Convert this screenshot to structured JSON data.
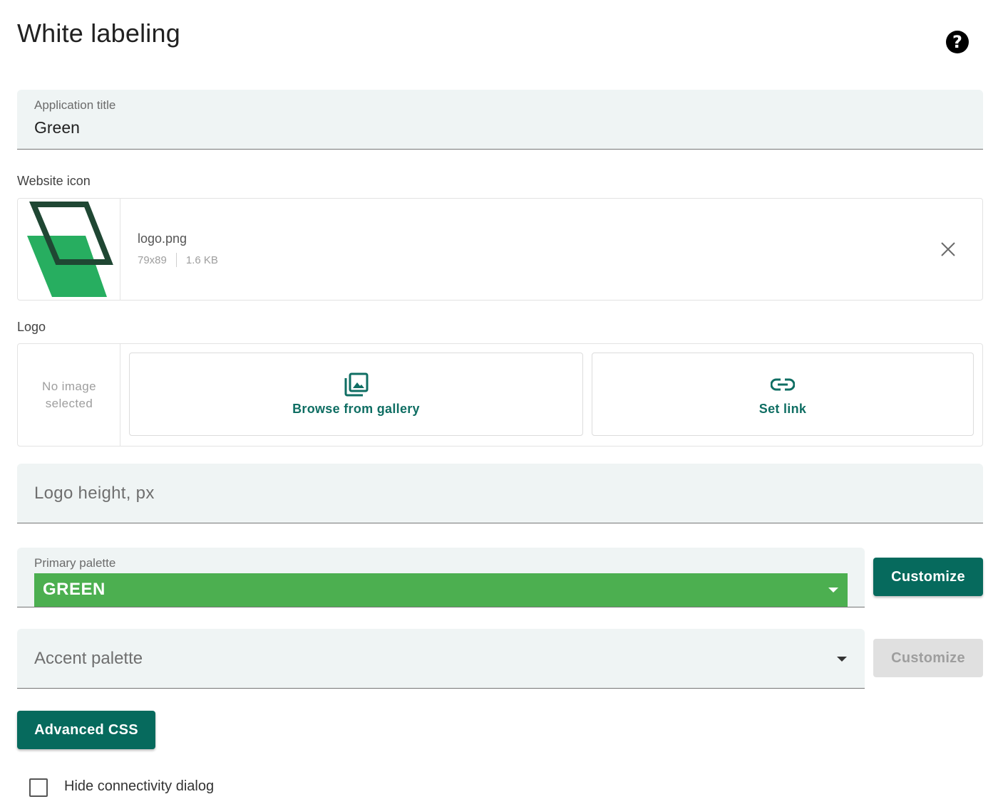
{
  "page": {
    "title": "White labeling",
    "help_icon": "?"
  },
  "app_title": {
    "label": "Application title",
    "value": "Green"
  },
  "website_icon": {
    "label": "Website icon",
    "file_name": "logo.png",
    "dimensions": "79x89",
    "size": "1.6 KB",
    "icon_color_dark": "#1f4733",
    "icon_color_green": "#27ae60"
  },
  "logo": {
    "label": "Logo",
    "no_image_text": "No image selected",
    "browse_label": "Browse from gallery",
    "set_link_label": "Set link"
  },
  "logo_height": {
    "placeholder": "Logo height, px"
  },
  "primary_palette": {
    "label": "Primary palette",
    "value": "GREEN",
    "color": "#4caf50",
    "customize_label": "Customize"
  },
  "accent_palette": {
    "placeholder": "Accent palette",
    "customize_label": "Customize"
  },
  "advanced_css": {
    "label": "Advanced CSS"
  },
  "hide_connectivity": {
    "label": "Hide connectivity dialog",
    "checked": false
  },
  "colors": {
    "accent": "#066a5d",
    "field_bg": "#eff4f4"
  }
}
